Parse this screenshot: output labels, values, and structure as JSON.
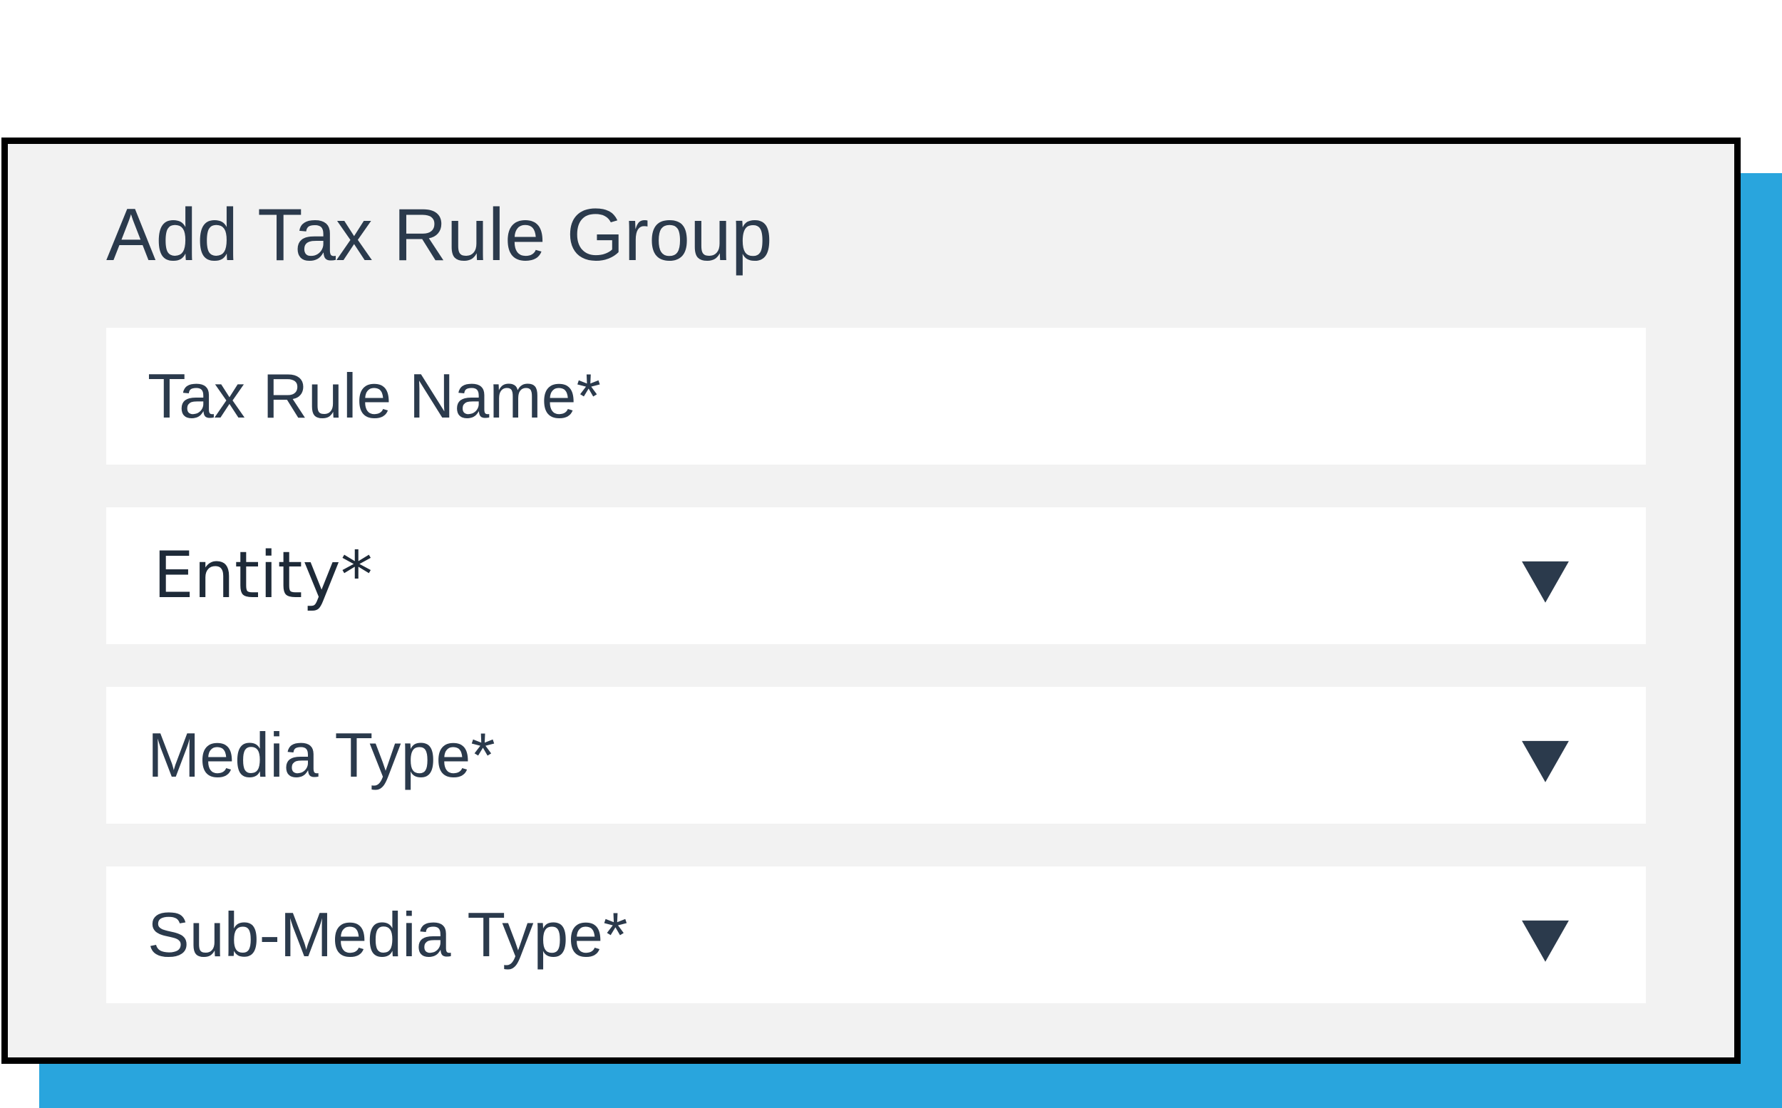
{
  "dialog": {
    "title": "Add Tax Rule Group"
  },
  "fields": [
    {
      "label": "Tax Rule Name*",
      "type": "text"
    },
    {
      "label": "Entity*",
      "type": "select",
      "icon": "chevron-down-icon"
    },
    {
      "label": "Media Type*",
      "type": "select",
      "icon": "chevron-down-icon"
    },
    {
      "label": "Sub-Media Type*",
      "type": "select",
      "icon": "chevron-down-icon"
    }
  ],
  "colors": {
    "panel_background": "#f2f2f2",
    "field_background": "#ffffff",
    "text": "#2b3a4c",
    "border": "#000000",
    "accent_shadow": "#29a5dd"
  }
}
